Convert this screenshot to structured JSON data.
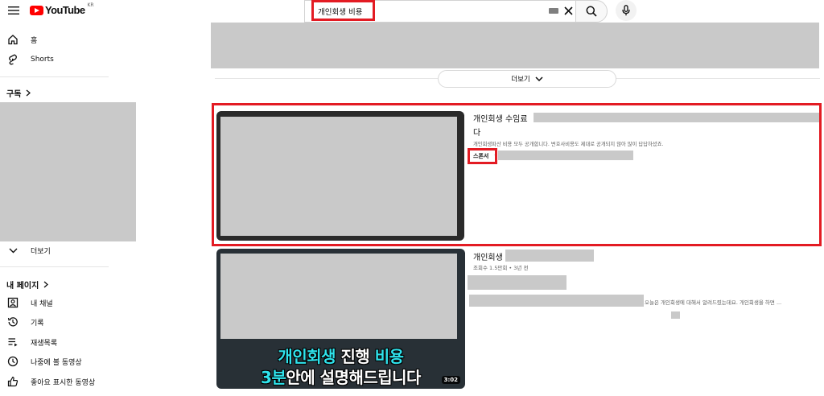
{
  "app": {
    "logo_text": "YouTube",
    "country_code": "KR"
  },
  "search": {
    "query": "개인회생 비용"
  },
  "sidebar": {
    "items": [
      {
        "label": "홈",
        "icon": "home-icon"
      },
      {
        "label": "Shorts",
        "icon": "shorts-icon"
      }
    ],
    "subscriptions_heading": "구독",
    "more_label": "더보기",
    "you_heading": "내 페이지",
    "you_items": [
      {
        "label": "내 채널",
        "icon": "channel-icon"
      },
      {
        "label": "기록",
        "icon": "history-icon"
      },
      {
        "label": "재생목록",
        "icon": "playlist-icon"
      },
      {
        "label": "나중에 볼 동영상",
        "icon": "watch-later-icon"
      },
      {
        "label": "좋아요 표시한 동영상",
        "icon": "like-icon"
      }
    ]
  },
  "main": {
    "more_button_label": "더보기",
    "results": [
      {
        "title_visible": "개인회생 수임료",
        "title_wrap": "다",
        "description": "개인회생파산 비용 모두 공개합니다. 변호사비용도 제대로 공개되지 않아 많이 답답하셨죠.",
        "badge": "스폰서",
        "badge_suffix": "·",
        "highlighted": true
      },
      {
        "title_visible": "개인회생",
        "meta": "조회수 1.5만회 • 3년 전",
        "snippet": "오늘은 개인회생에 대해서 알려드렸는데요. 개인회생을 하면 ...",
        "thumbnail_text_line1_part1": "개인회생",
        "thumbnail_text_line1_part2": " 진행 ",
        "thumbnail_text_line1_part3": "비용",
        "thumbnail_text_line2_part1": "3분",
        "thumbnail_text_line2_part2": "안에 설명해드립니다",
        "duration": "3:02"
      }
    ]
  },
  "colors": {
    "highlight": "#e31b23",
    "redaction": "#c9c9c9",
    "brand": "#ff0000",
    "thumbnail_accent": "#2fe3ec"
  }
}
